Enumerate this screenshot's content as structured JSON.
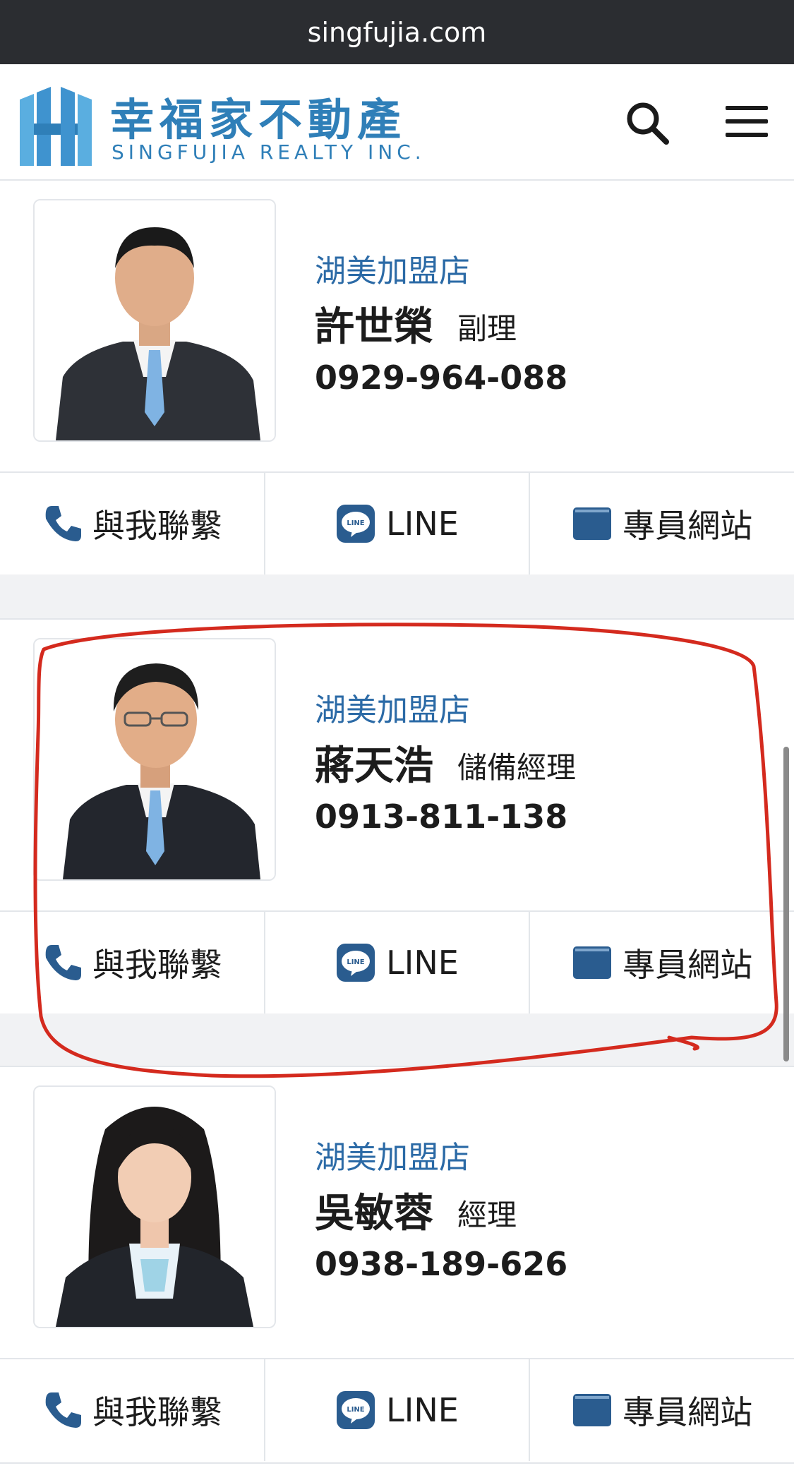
{
  "browser": {
    "url": "singfujia.com"
  },
  "header": {
    "logo_cn": "幸福家不動產",
    "logo_en": "SINGFUJIA REALTY INC."
  },
  "colors": {
    "brand": "#2f7fb8",
    "store_text": "#2b6aa6",
    "icon_blue": "#2a5c8f",
    "annotation_red": "#d42a1e"
  },
  "agents": [
    {
      "store": "湖美加盟店",
      "name": "許世榮",
      "title": "副理",
      "phone": "0929-964-088"
    },
    {
      "store": "湖美加盟店",
      "name": "蔣天浩",
      "title": "儲備經理",
      "phone": "0913-811-138"
    },
    {
      "store": "湖美加盟店",
      "name": "吳敏蓉",
      "title": "經理",
      "phone": "0938-189-626"
    }
  ],
  "actions": {
    "contact_label": "與我聯繫",
    "line_label": "LINE",
    "site_label": "專員網站",
    "contact_icon": "phone-icon",
    "line_icon": "line-icon",
    "site_icon": "website-icon"
  }
}
